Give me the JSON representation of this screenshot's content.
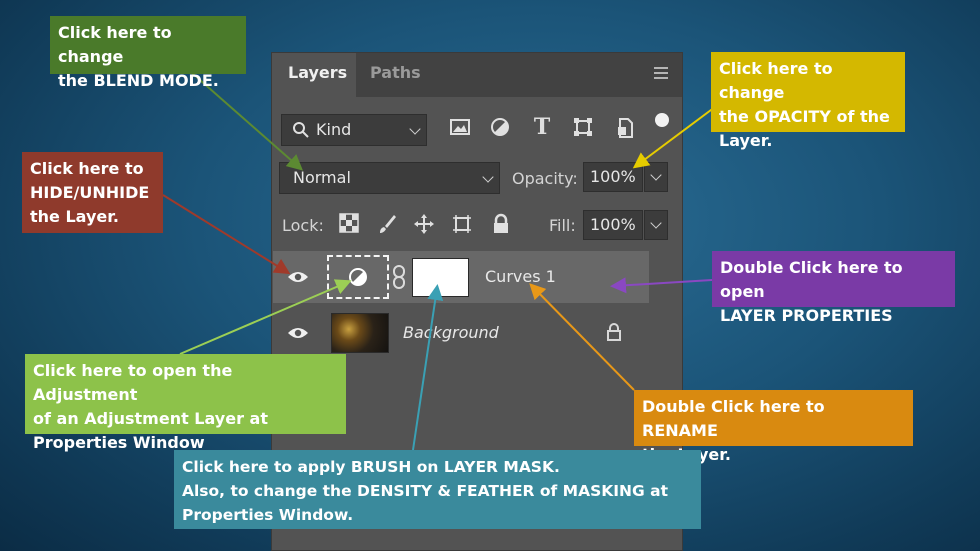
{
  "panel": {
    "tabs": [
      {
        "label": "Layers",
        "active": true
      },
      {
        "label": "Paths",
        "active": false
      }
    ],
    "filter": {
      "label": "Kind"
    },
    "blend_mode": "Normal",
    "opacity": {
      "label": "Opacity:",
      "value": "100%"
    },
    "lock": {
      "label": "Lock:"
    },
    "fill": {
      "label": "Fill:",
      "value": "100%"
    },
    "layers": [
      {
        "name": "Curves 1",
        "visible": true,
        "type": "adjustment"
      },
      {
        "name": "Background",
        "visible": true,
        "type": "pixel",
        "locked": true
      }
    ]
  },
  "annotations": {
    "blend_mode": {
      "line1": "Click here to change",
      "line2": "the BLEND MODE.",
      "color": "#4a7a2a"
    },
    "opacity": {
      "line1": "Click here to change",
      "line2": "the OPACITY of the",
      "line3": "Layer.",
      "color": "#d4b800"
    },
    "hide": {
      "line1": "Click here to",
      "line2": "HIDE/UNHIDE",
      "line3": "the Layer.",
      "color": "#8f3a2c"
    },
    "properties": {
      "line1": "Double Click here to open",
      "line2": "LAYER PROPERTIES",
      "color": "#7a3aa6"
    },
    "adjustment": {
      "line1": "Click here to open the Adjustment",
      "line2": "of an Adjustment Layer at",
      "line3": "Properties Window",
      "color": "#8dc24a"
    },
    "rename": {
      "line1": "Double Click here to RENAME",
      "line2": "the Layer.",
      "color": "#d98a10"
    },
    "mask": {
      "line1": "Click here to apply BRUSH on LAYER MASK.",
      "line2": "Also, to change the DENSITY & FEATHER of MASKING at",
      "line3": "Properties Window.",
      "color": "#3a8a9c"
    }
  }
}
